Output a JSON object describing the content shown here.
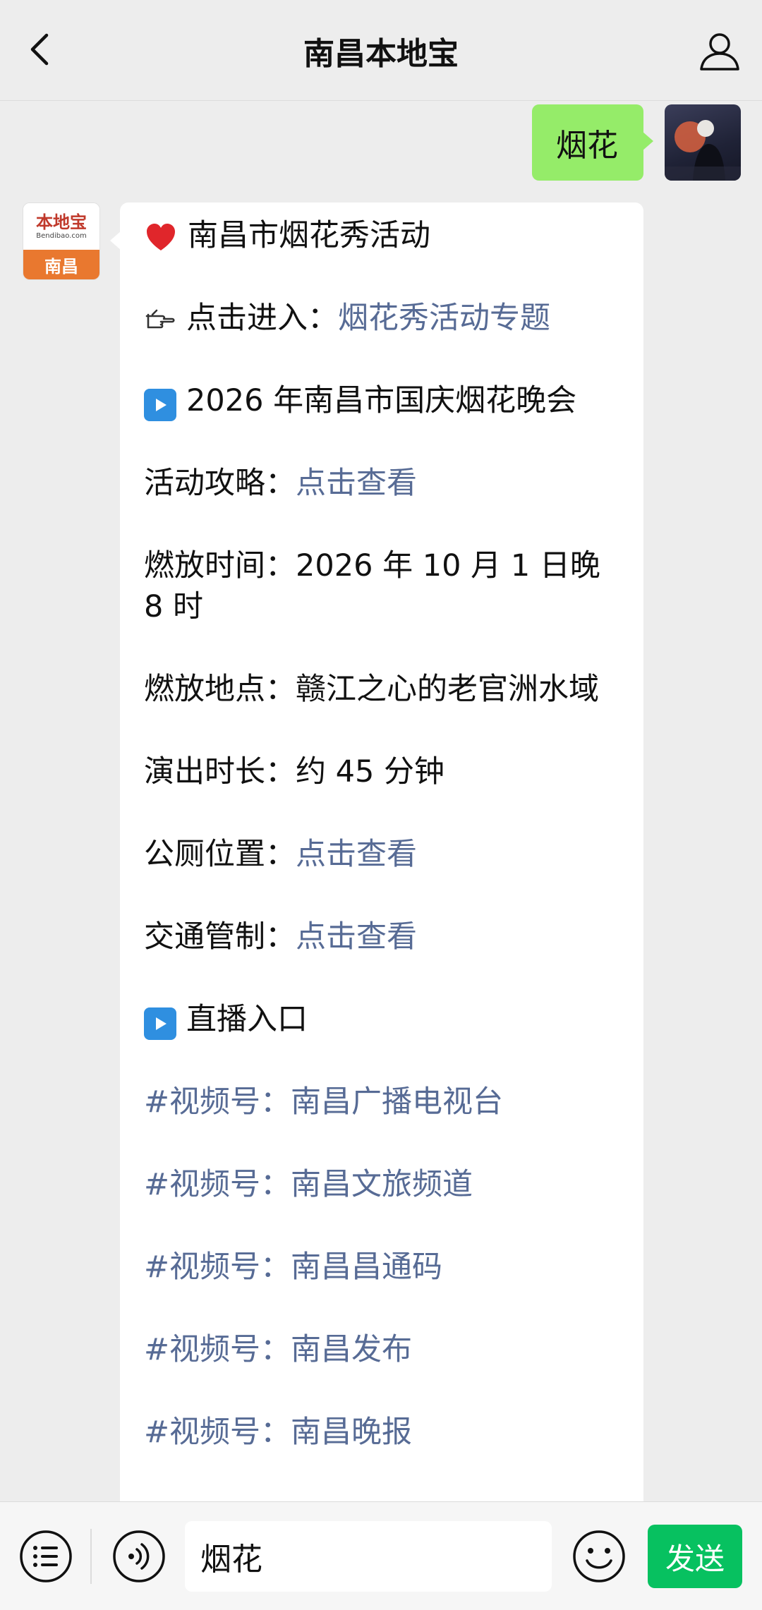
{
  "header": {
    "title": "南昌本地宝"
  },
  "outgoing": {
    "text": "烟花"
  },
  "bot": {
    "logo_text": "本地宝",
    "logo_sub": "Bendibao.com",
    "logo_city": "南昌"
  },
  "message": {
    "line1": "南昌市烟花秀活动",
    "line2_label": "点击进入：",
    "line2_link": "烟花秀活动专题",
    "line3": "2026 年南昌市国庆烟花晚会",
    "guide_label": "活动攻略：",
    "guide_link": "点击查看",
    "time": "燃放时间：2026 年 10 月 1 日晚 8 时",
    "place": "燃放地点：赣江之心的老官洲水域",
    "duration": "演出时长：约 45 分钟",
    "toilet_label": "公厕位置：",
    "toilet_link": "点击查看",
    "traffic_label": "交通管制：",
    "traffic_link": "点击查看",
    "live_title": "直播入口",
    "channels": [
      "#视频号：南昌广播电视台",
      "#视频号：南昌文旅频道",
      "#视频号：南昌昌通码",
      "#视频号：南昌发布",
      "#视频号：南昌晚报"
    ]
  },
  "input": {
    "value": "烟花"
  },
  "send_label": "发送"
}
